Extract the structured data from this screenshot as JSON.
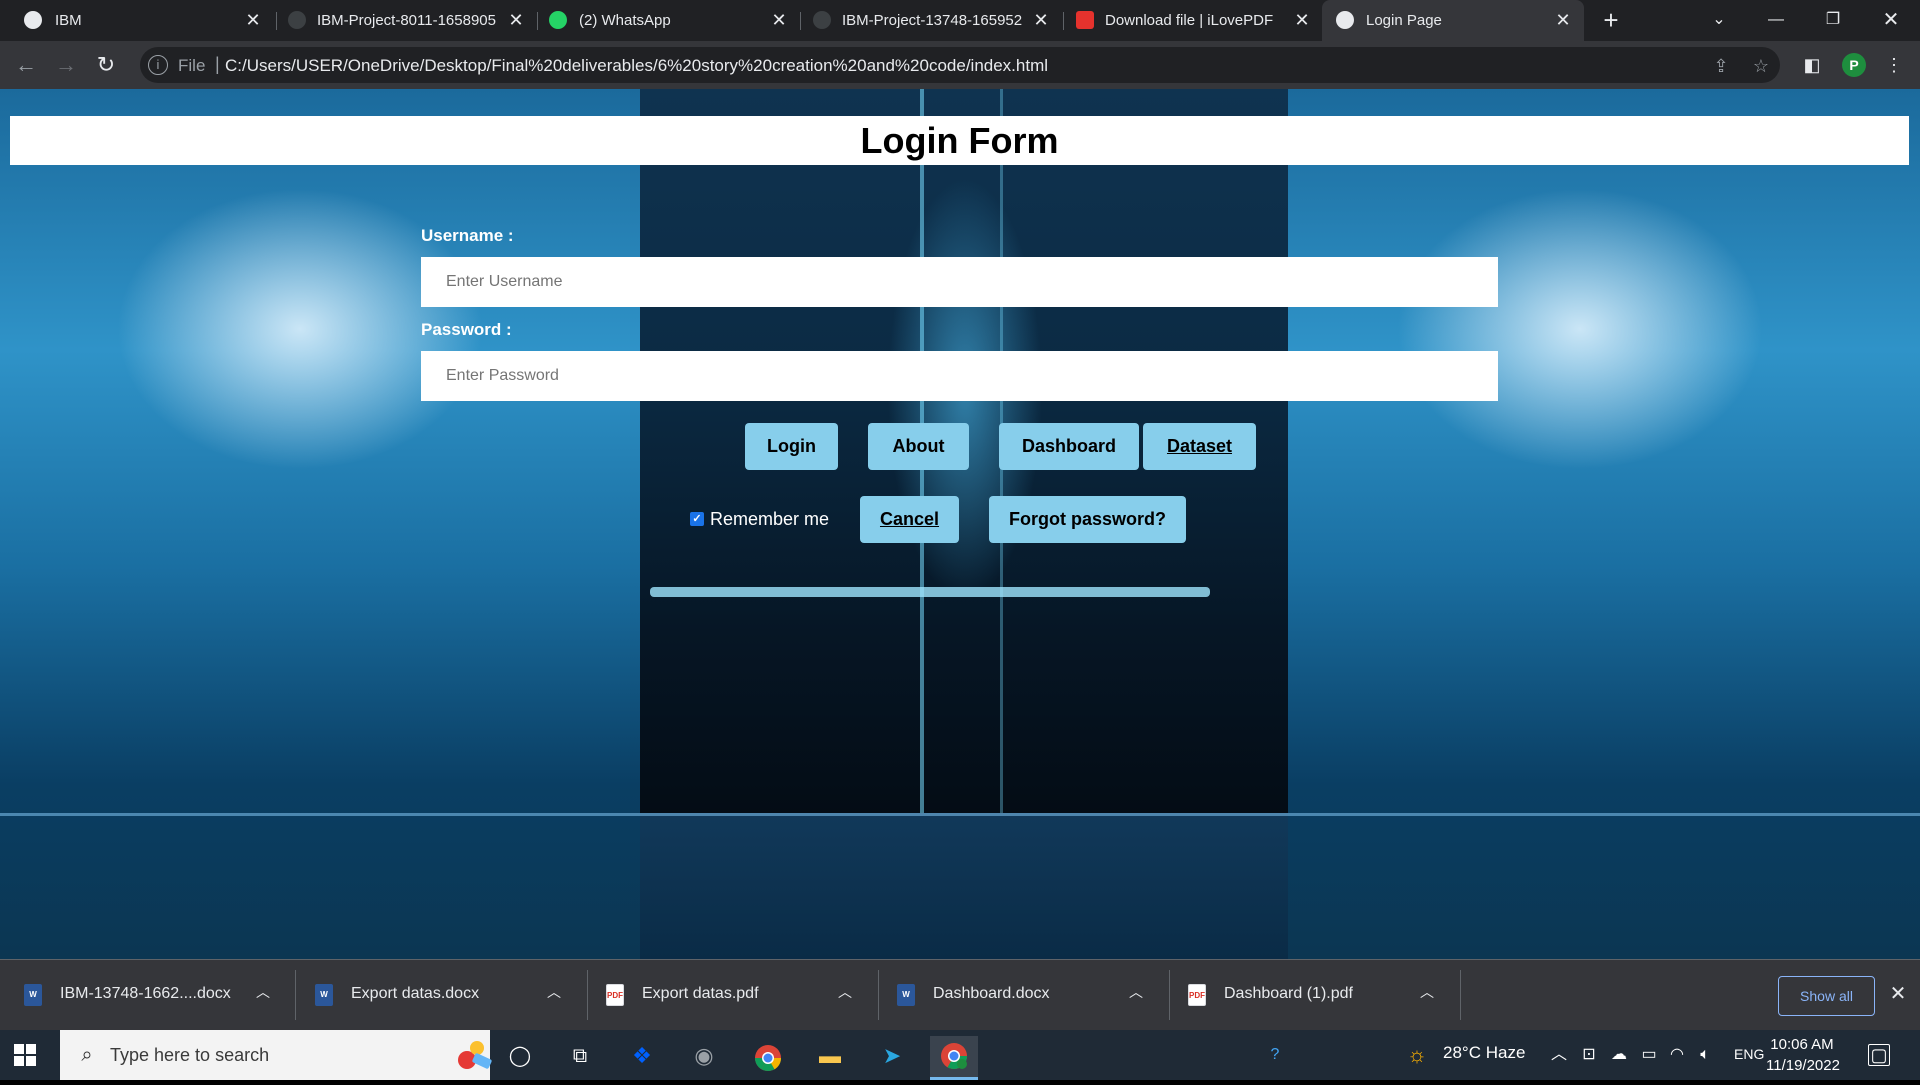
{
  "browser": {
    "tabs": [
      {
        "title": "IBM",
        "icon": "globe-icon"
      },
      {
        "title": "IBM-Project-8011-1658905",
        "icon": "github-icon"
      },
      {
        "title": "(2) WhatsApp",
        "icon": "whatsapp-icon"
      },
      {
        "title": "IBM-Project-13748-165952",
        "icon": "github-icon"
      },
      {
        "title": "Download file | iLovePDF",
        "icon": "ilovepdf-icon"
      },
      {
        "title": "Login Page",
        "icon": "globe-icon",
        "active": true
      }
    ],
    "omnibox": {
      "scheme_label": "File",
      "url": "C:/Users/USER/OneDrive/Desktop/Final%20deliverables/6%20story%20creation%20and%20code/index.html"
    },
    "profile_initial": "P"
  },
  "page": {
    "title": "Login Form",
    "username_label": "Username :",
    "username_placeholder": "Enter Username",
    "password_label": "Password :",
    "password_placeholder": "Enter Password",
    "buttons": {
      "login": "Login",
      "about": "About",
      "dashboard": "Dashboard",
      "dataset": "Dataset",
      "cancel": "Cancel",
      "forgot": "Forgot password?"
    },
    "remember_label": "Remember me",
    "remember_checked": true,
    "button_color": "#87ceeb"
  },
  "downloads": {
    "items": [
      {
        "name": "IBM-13748-1662....docx",
        "type": "word"
      },
      {
        "name": "Export datas.docx",
        "type": "word"
      },
      {
        "name": "Export datas.pdf",
        "type": "pdf"
      },
      {
        "name": "Dashboard.docx",
        "type": "word"
      },
      {
        "name": "Dashboard (1).pdf",
        "type": "pdf"
      }
    ],
    "show_all_label": "Show all"
  },
  "taskbar": {
    "search_placeholder": "Type here to search",
    "apps": [
      "cortana-icon",
      "task-view-icon",
      "dropbox-icon",
      "camera-icon",
      "chrome-icon",
      "file-explorer-icon",
      "telegram-icon",
      "chrome-profile-icon"
    ],
    "weather": "28°C  Haze",
    "language": "ENG",
    "time": "10:06 AM",
    "date": "11/19/2022"
  }
}
